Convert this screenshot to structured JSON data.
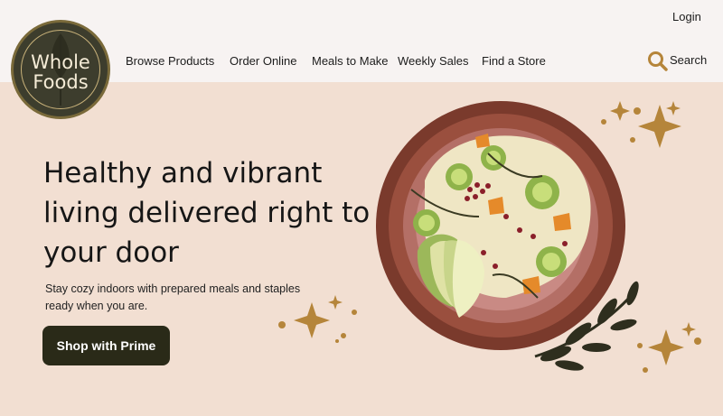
{
  "brand": {
    "line1": "Whole",
    "line2": "Foods"
  },
  "header": {
    "login": "Login",
    "search_label": "Search",
    "nav": [
      "Browse Products",
      "Order Online",
      "Meals to Make",
      "Weekly Sales",
      "Find a Store"
    ]
  },
  "hero": {
    "headline": "Healthy and vibrant living delivered right to your door",
    "subtext": "Stay cozy indoors with prepared meals and staples ready when you are.",
    "cta": "Shop with Prime"
  },
  "colors": {
    "header_bg": "#f7f3f2",
    "hero_bg": "#f2dfd2",
    "logo_bg": "#3d3d2d",
    "cta_bg": "#2a2a18",
    "accent_gold": "#b5853a",
    "plate_rim": "#7a3a2c"
  },
  "icons": [
    "search-icon",
    "sparkle-icon",
    "leaf-icon"
  ]
}
